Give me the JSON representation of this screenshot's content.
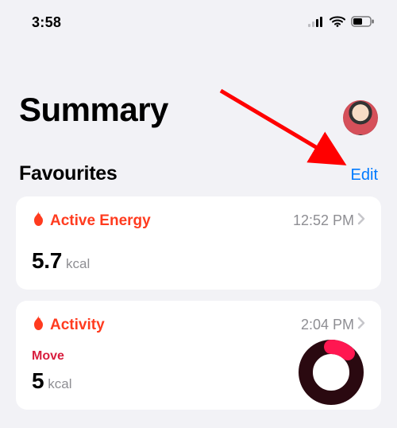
{
  "status": {
    "time": "3:58"
  },
  "header": {
    "title": "Summary"
  },
  "favourites": {
    "heading": "Favourites",
    "edit_label": "Edit"
  },
  "cards": {
    "active_energy": {
      "title": "Active Energy",
      "time": "12:52 PM",
      "value": "5.7",
      "unit": "kcal"
    },
    "activity": {
      "title": "Activity",
      "time": "2:04 PM",
      "move_label": "Move",
      "value": "5",
      "unit": "kcal"
    }
  },
  "colors": {
    "accent_orange": "#ff3b1f",
    "accent_red": "#d81e3e",
    "link_blue": "#007aff"
  }
}
